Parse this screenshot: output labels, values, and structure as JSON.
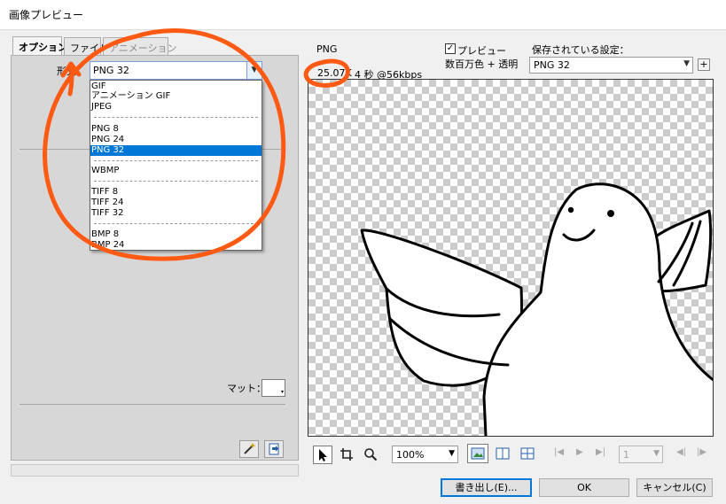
{
  "window": {
    "title": "画像プレビュー"
  },
  "tabs": [
    {
      "label": "オプション",
      "state": "active"
    },
    {
      "label": "ファイル",
      "state": "normal"
    },
    {
      "label": "アニメーション",
      "state": "disabled"
    }
  ],
  "options": {
    "format_label": "形式：",
    "format_value": "PNG 32",
    "dropdown_items": [
      "GIF",
      "アニメーション GIF",
      "JPEG",
      "PNG 8",
      "PNG 24",
      "PNG 32",
      "WBMP",
      "TIFF 8",
      "TIFF 24",
      "TIFF 32",
      "BMP 8",
      "BMP 24"
    ],
    "dropdown_selected": "PNG 32",
    "matte_label": "マット：",
    "wand_icon": "magic-wand-icon",
    "export_icon": "export-frame-icon"
  },
  "preview": {
    "format": "PNG",
    "preview_checkbox_label": "プレビュー",
    "preview_checked": true,
    "color_info": "数百万色 + 透明",
    "saved_settings_label": "保存されている設定：",
    "saved_settings_value": "PNG 32",
    "add_preset": "+",
    "file_size": "25.07K",
    "download_time": "4 秒 @56kbps"
  },
  "toolbar": {
    "pointer_icon": "pointer-icon",
    "crop_icon": "crop-icon",
    "zoom_icon": "magnifier-icon",
    "zoom_value": "100%",
    "frame_value": "1",
    "views": [
      "single-view-icon",
      "two-up-view-icon",
      "four-up-view-icon"
    ]
  },
  "buttons": {
    "export": "書き出し(E)...",
    "ok": "OK",
    "cancel": "キャンセル(C)"
  },
  "colors": {
    "annotation": "#ff5a14",
    "selection": "#0078d7",
    "checker": "#cccccc"
  }
}
